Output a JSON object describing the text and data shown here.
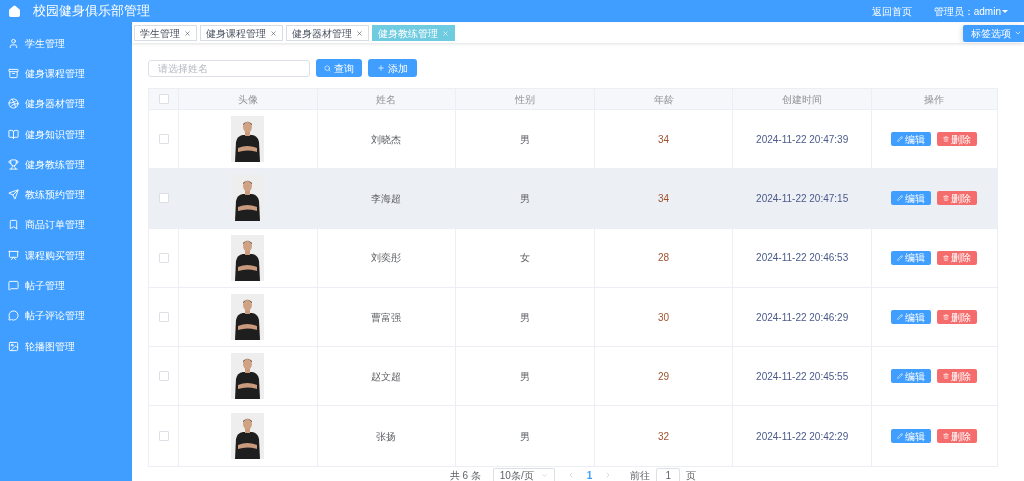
{
  "header": {
    "title": "校园健身俱乐部管理",
    "home_link": "返回首页",
    "user_menu": "管理员：admin"
  },
  "sidebar": {
    "items": [
      {
        "label": "学生管理"
      },
      {
        "label": "健身课程管理"
      },
      {
        "label": "健身器材管理"
      },
      {
        "label": "健身知识管理"
      },
      {
        "label": "健身教练管理"
      },
      {
        "label": "教练预约管理"
      },
      {
        "label": "商品订单管理"
      },
      {
        "label": "课程购买管理"
      },
      {
        "label": "帖子管理"
      },
      {
        "label": "帖子评论管理"
      },
      {
        "label": "轮播图管理"
      }
    ]
  },
  "tabs": [
    {
      "label": "学生管理",
      "selected": false
    },
    {
      "label": "健身课程管理",
      "selected": false
    },
    {
      "label": "健身器材管理",
      "selected": false
    },
    {
      "label": "健身教练管理",
      "selected": true
    }
  ],
  "tab_options": "标签选项",
  "search": {
    "placeholder": "请选择姓名",
    "search_button": "查询",
    "add_button": "添加"
  },
  "table": {
    "select_all_checked": false,
    "columns": [
      "头像",
      "姓名",
      "性别",
      "年龄",
      "创建时间",
      "操作"
    ],
    "rows": [
      {
        "checked": false,
        "hovered": false,
        "name": "刘晓杰",
        "gender": "男",
        "age": "34",
        "created": "2024-11-22 20:47:39",
        "edit": "编辑",
        "delete": "删除"
      },
      {
        "checked": false,
        "hovered": true,
        "name": "李海超",
        "gender": "男",
        "age": "34",
        "created": "2024-11-22 20:47:15",
        "edit": "编辑",
        "delete": "删除"
      },
      {
        "checked": false,
        "hovered": false,
        "name": "刘奕彤",
        "gender": "女",
        "age": "28",
        "created": "2024-11-22 20:46:53",
        "edit": "编辑",
        "delete": "删除"
      },
      {
        "checked": false,
        "hovered": false,
        "name": "曹富强",
        "gender": "男",
        "age": "30",
        "created": "2024-11-22 20:46:29",
        "edit": "编辑",
        "delete": "删除"
      },
      {
        "checked": false,
        "hovered": false,
        "name": "赵文超",
        "gender": "男",
        "age": "29",
        "created": "2024-11-22 20:45:55",
        "edit": "编辑",
        "delete": "删除"
      },
      {
        "checked": false,
        "hovered": false,
        "name": "张扬",
        "gender": "男",
        "age": "32",
        "created": "2024-11-22 20:42:29",
        "edit": "编辑",
        "delete": "删除"
      }
    ]
  },
  "pagination": {
    "total": "共 6 条",
    "page_size": "10条/页",
    "pages": [
      {
        "label": "1",
        "selected": true
      }
    ],
    "goto_label": "前往",
    "goto_value": "1",
    "goto_suffix": "页"
  }
}
